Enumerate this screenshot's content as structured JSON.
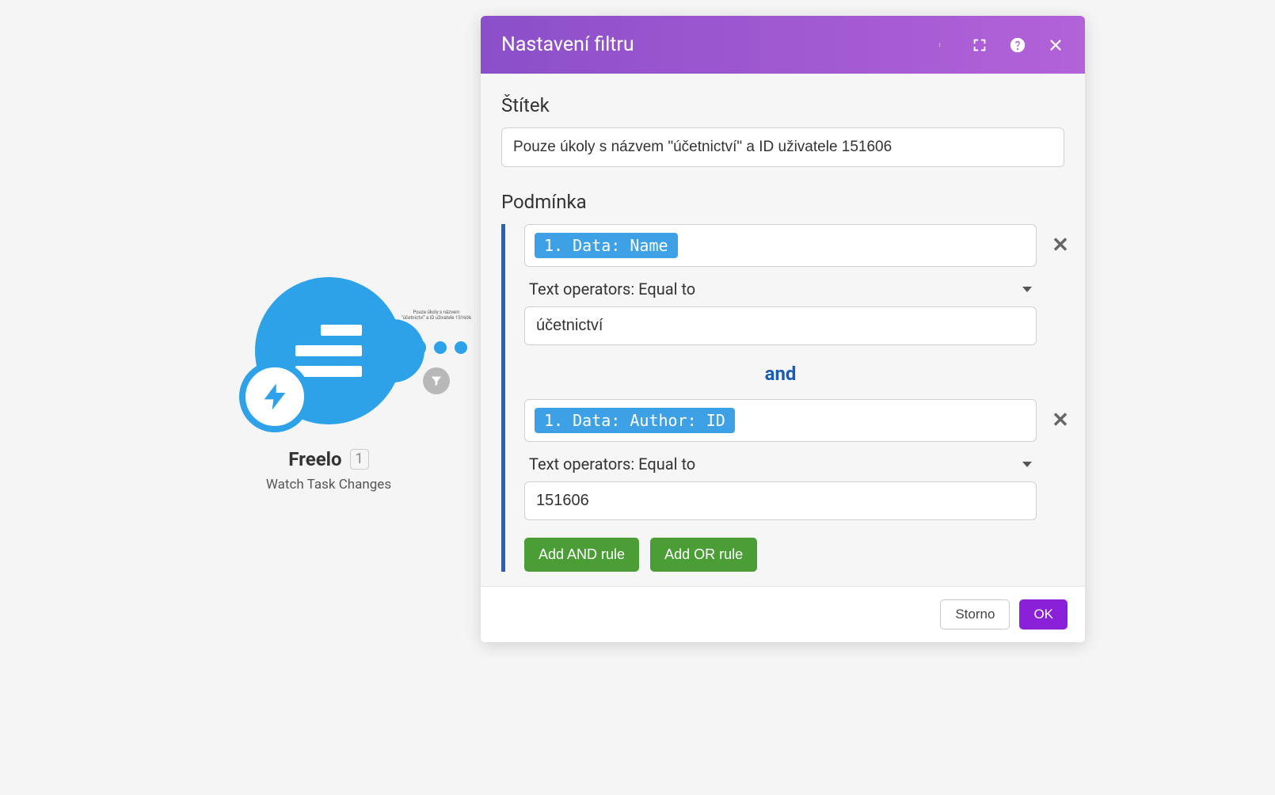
{
  "canvas": {
    "module": {
      "title": "Freelo",
      "step": "1",
      "subtitle": "Watch Task Changes"
    },
    "connector_caption": "Pouze úkoly s názvem \"účetnictví\" a ID uživatele 151606"
  },
  "modal": {
    "title": "Nastavení filtru",
    "label_section": "Štítek",
    "label_value": "Pouze úkoly s názvem \"účetnictví\" a ID uživatele 151606",
    "condition_section": "Podmínka",
    "and_separator": "and",
    "conditions": [
      {
        "field_badge": "1. Data: Name",
        "operator": "Text operators: Equal to",
        "value": "účetnictví"
      },
      {
        "field_badge": "1. Data: Author: ID",
        "operator": "Text operators: Equal to",
        "value": "151606"
      }
    ],
    "buttons": {
      "add_and": "Add AND rule",
      "add_or": "Add OR rule"
    },
    "footer": {
      "cancel": "Storno",
      "ok": "OK"
    }
  }
}
